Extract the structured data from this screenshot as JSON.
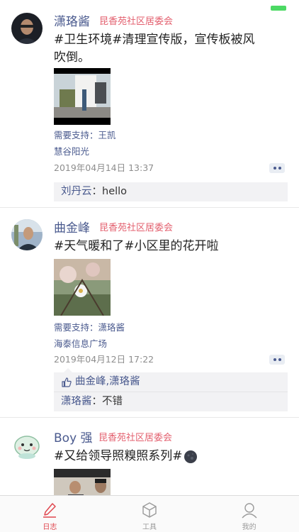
{
  "posts": [
    {
      "name": "潇珞酱",
      "org": "昆香苑社区居委会",
      "content": "#卫生环境#清理宣传版，宣传板被风吹倒。",
      "support": "需要支持：王凯",
      "location": "慧谷阳光",
      "time": "2019年04月14日 13:37",
      "comment": {
        "name": "刘丹云",
        "text": "：hello"
      }
    },
    {
      "name": "曲金峰",
      "org": "昆香苑社区居委会",
      "content": "#天气暖和了#小区里的花开啦",
      "support": "需要支持：潇珞酱",
      "location": "海泰信息广场",
      "time": "2019年04月12日 17:22",
      "likes": "曲金峰,潇珞酱",
      "comment": {
        "name": "潇珞酱",
        "text": "：不错"
      }
    },
    {
      "name": "Boy 强",
      "org": "昆香苑社区居委会",
      "content": "#又给领导照糗照系列#"
    }
  ],
  "tabs": [
    {
      "label": "日志",
      "icon": "pencil-icon",
      "active": true
    },
    {
      "label": "工具",
      "icon": "cube-icon",
      "active": false
    },
    {
      "label": "我的",
      "icon": "person-icon",
      "active": false
    }
  ],
  "colors": {
    "name": "#4a5a8e",
    "org": "#e35f6e",
    "active_tab": "#e0464e",
    "battery": "#4cd964"
  }
}
